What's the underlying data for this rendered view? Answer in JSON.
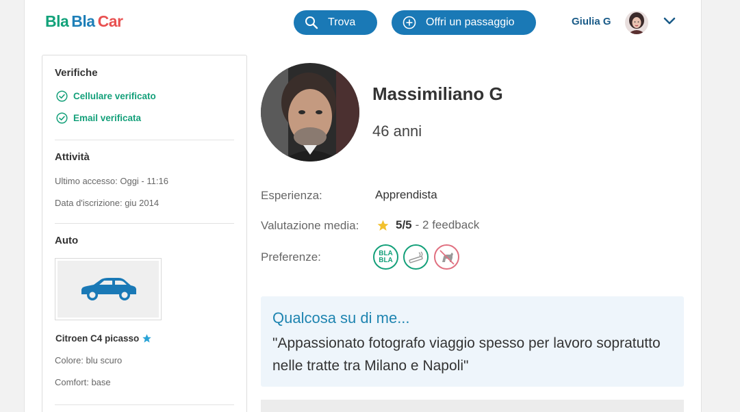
{
  "header": {
    "logo": {
      "part1": "Bla",
      "part2": "Bla",
      "part3": "Car"
    },
    "find_label": "Trova",
    "offer_label": "Offri un passaggio",
    "user_name": "Giulia G"
  },
  "sidebar": {
    "verifications": {
      "title": "Verifiche",
      "items": [
        "Cellulare verificato",
        "Email verificata"
      ]
    },
    "activity": {
      "title": "Attività",
      "last_access": "Ultimo accesso: Oggi - 11:16",
      "signup_date": "Data d'iscrizione: giu 2014"
    },
    "car": {
      "title": "Auto",
      "model": "Citroen C4 picasso",
      "color": "Colore: blu scuro",
      "comfort": "Comfort: base"
    }
  },
  "profile": {
    "name": "Massimiliano G",
    "age": "46 anni",
    "experience_label": "Esperienza:",
    "experience_value": "Apprendista",
    "rating_label": "Valutazione media:",
    "rating_value": "5/5",
    "rating_feedback": "- 2 feedback",
    "preferences_label": "Preferenze:",
    "preferences": [
      "bla-bla-chat-icon",
      "no-smoking-icon",
      "no-pets-icon"
    ]
  },
  "about": {
    "title": "Qualcosa su di me...",
    "text": "\"Appassionato fotografo viaggio spesso per lavoro sopratutto nelle tratte tra Milano e Napoli\""
  },
  "colors": {
    "brand_blue": "#1a79b6",
    "brand_green": "#14a07a",
    "brand_red": "#e85050"
  }
}
